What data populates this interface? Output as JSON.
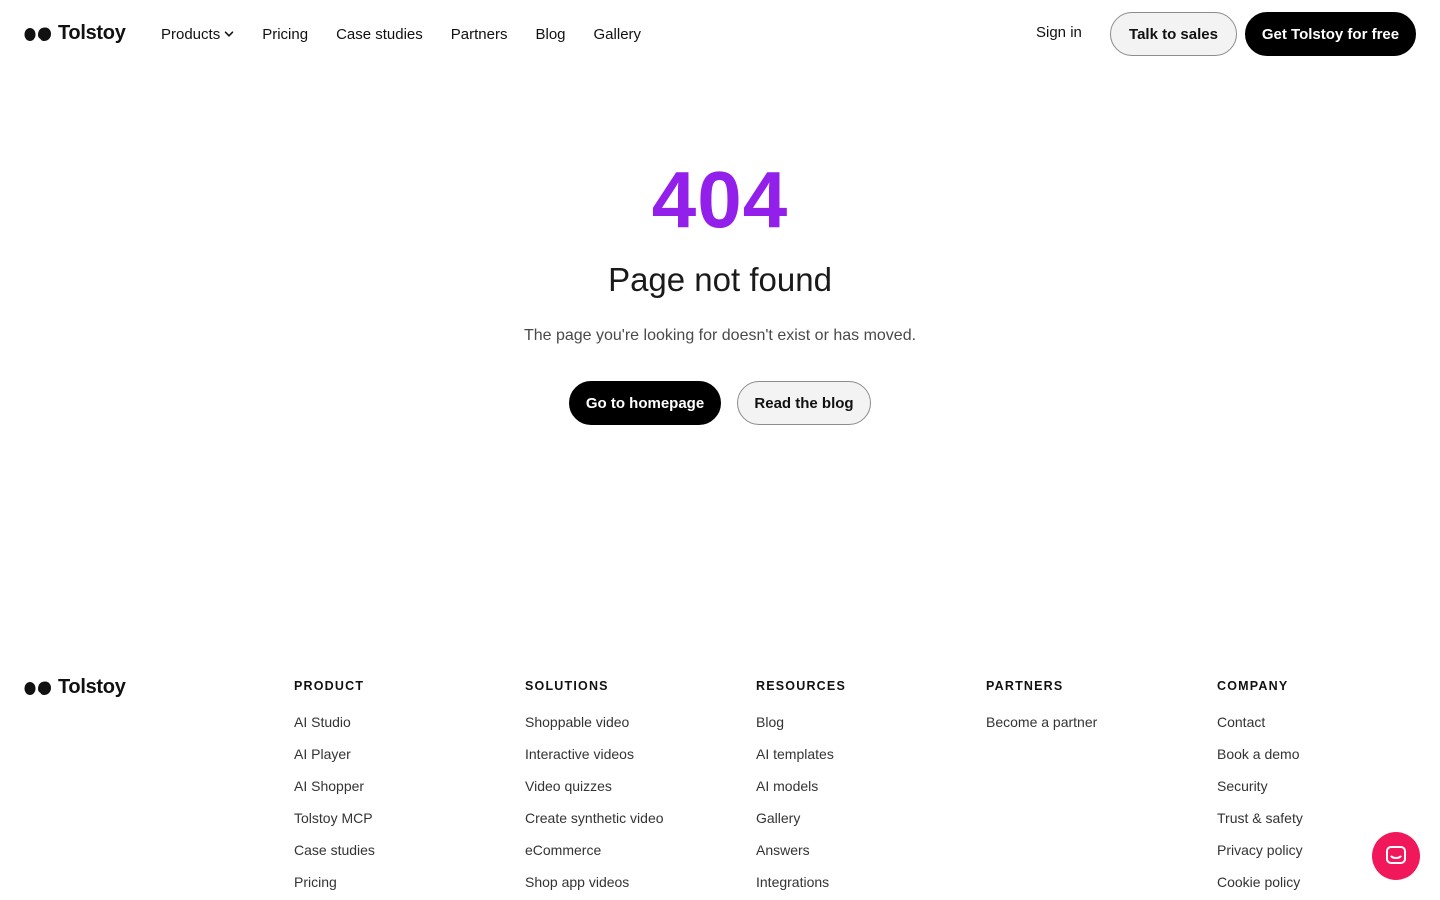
{
  "brand": {
    "name": "Tolstoy"
  },
  "nav": {
    "items": [
      {
        "label": "Products",
        "has_dropdown": true
      },
      {
        "label": "Pricing"
      },
      {
        "label": "Case studies"
      },
      {
        "label": "Partners"
      },
      {
        "label": "Blog"
      },
      {
        "label": "Gallery"
      }
    ],
    "sign_in": "Sign in",
    "talk_to_sales": "Talk to sales",
    "get_free": "Get Tolstoy for free"
  },
  "error": {
    "code": "404",
    "title": "Page not found",
    "description": "The page you're looking for doesn't exist or has moved.",
    "primary_cta": "Go to homepage",
    "secondary_cta": "Read the blog"
  },
  "footer": {
    "columns": [
      {
        "title": "PRODUCT",
        "links": [
          "AI Studio",
          "AI Player",
          "AI Shopper",
          "Tolstoy MCP",
          "Case studies",
          "Pricing"
        ]
      },
      {
        "title": "SOLUTIONS",
        "links": [
          "Shoppable video",
          "Interactive videos",
          "Video quizzes",
          "Create synthetic video",
          "eCommerce",
          "Shop app videos"
        ]
      },
      {
        "title": "RESOURCES",
        "links": [
          "Blog",
          "AI templates",
          "AI models",
          "Gallery",
          "Answers",
          "Integrations"
        ]
      },
      {
        "title": "PARTNERS",
        "links": [
          "Become a partner"
        ]
      },
      {
        "title": "COMPANY",
        "links": [
          "Contact",
          "Book a demo",
          "Security",
          "Trust & safety",
          "Privacy policy",
          "Cookie policy"
        ]
      }
    ]
  },
  "colors": {
    "accent_purple": "#9320ea",
    "chat_pink": "#f0185b",
    "button_dark": "#000000"
  },
  "icons": {
    "logo": "tolstoy-quote-mark-icon",
    "dropdown": "chevron-down-icon",
    "chat": "chat-icon"
  }
}
